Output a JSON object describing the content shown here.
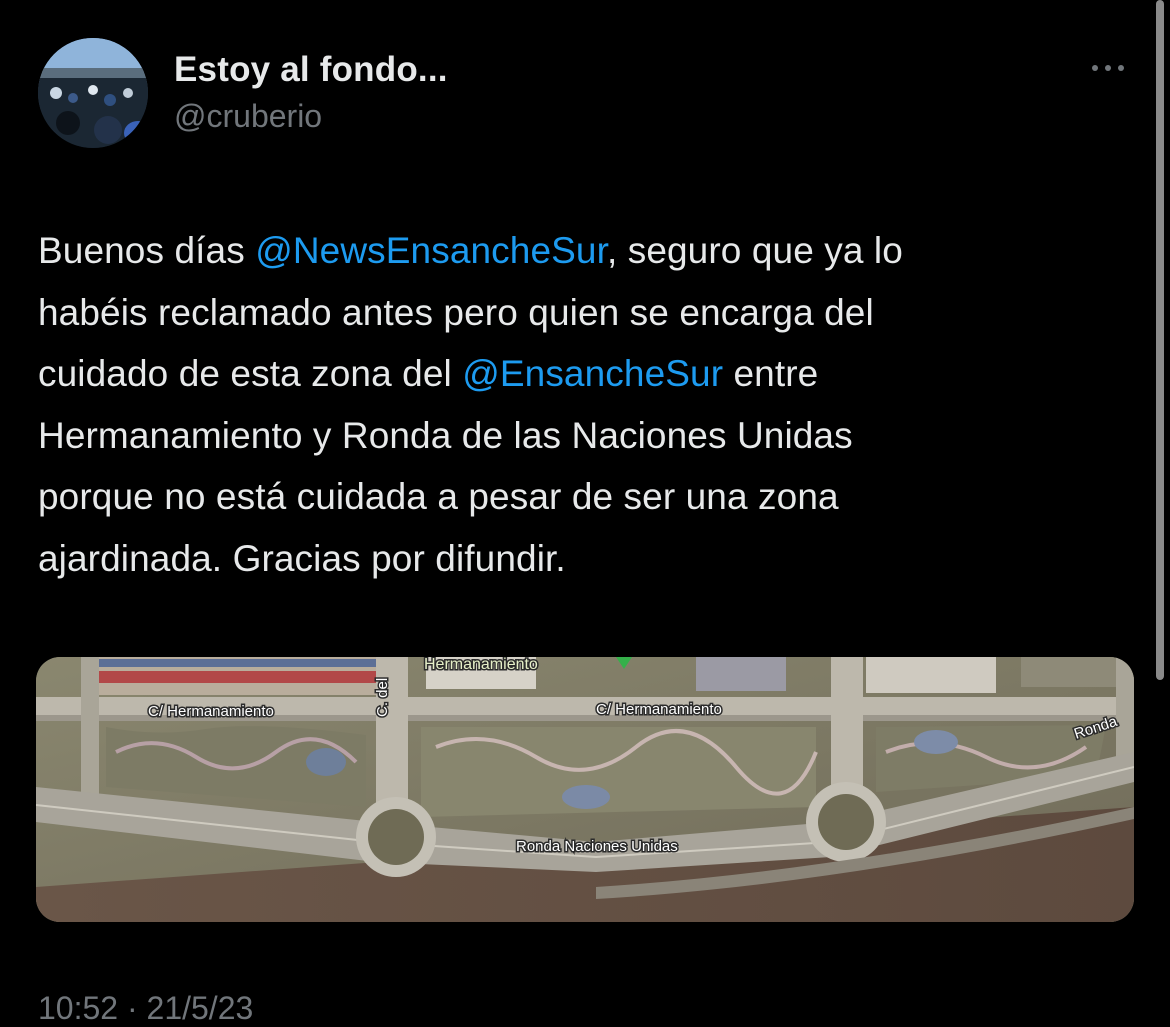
{
  "author": {
    "name": "Estoy al fondo...",
    "handle": "@cruberio",
    "avatar_icon": "profile-photo-stadium"
  },
  "more_menu_icon": "more-horizontal-icon",
  "tweet": {
    "line1_pre": "Buenos días ",
    "mention1": "@NewsEnsancheSur",
    "line1_post": ", seguro que ya lo",
    "line2": "habéis reclamado antes pero quien se encarga del",
    "line3_pre": "cuidado de esta zona del ",
    "mention2": "@EnsancheSur",
    "line3_post": " entre",
    "line4": "Hermanamiento y Ronda de las Naciones Unidas",
    "line5": "porque no está cuidada a pesar de ser una zona",
    "line6": "ajardinada. Gracias por difundir."
  },
  "media": {
    "type": "satellite map",
    "labels": {
      "hermanamiento_poi": "Hermanamiento",
      "street_left": "C/ Hermanamiento",
      "street_right": "C/ Hermanamiento",
      "street_vertical": "C. del",
      "ronda_corner": "Ronda",
      "ronda_main": "Ronda Naciones Unidas"
    }
  },
  "timestamp": "10:52 · 21/5/23",
  "colors": {
    "background": "#000000",
    "text": "#e7e9ea",
    "secondary": "#71767b",
    "mention": "#1d9bf0"
  }
}
